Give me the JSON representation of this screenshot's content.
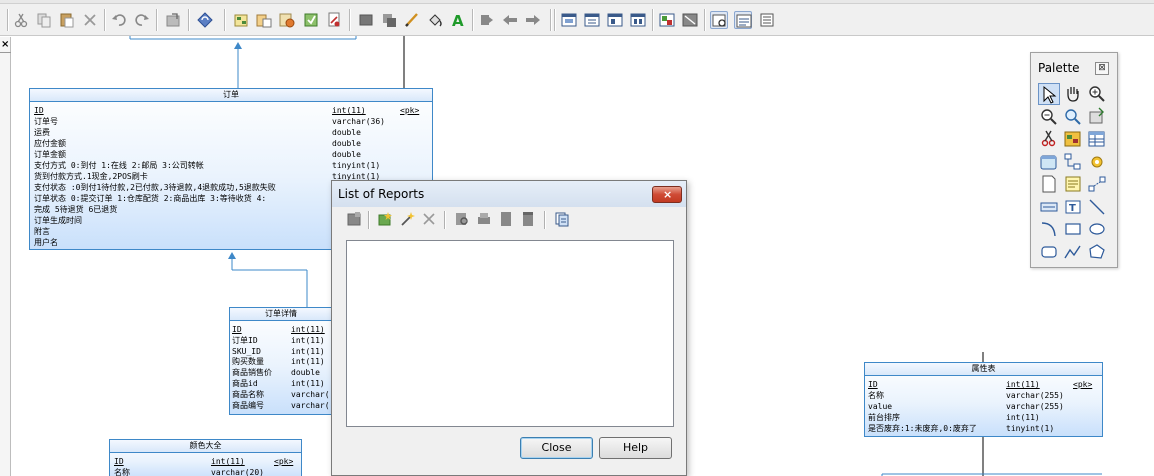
{
  "diagram": {
    "tables": [
      {
        "key": "order",
        "title": "订单",
        "rows": [
          {
            "name": "ID",
            "type": "int(11)",
            "key": "<pk>"
          },
          {
            "name": "订单号",
            "type": "varchar(36)",
            "key": ""
          },
          {
            "name": "运费",
            "type": "double",
            "key": ""
          },
          {
            "name": "应付金额",
            "type": "double",
            "key": ""
          },
          {
            "name": "订单金额",
            "type": "double",
            "key": ""
          },
          {
            "name": "支付方式 0:到付 1:在线 2:邮局 3:公司转帐",
            "type": "tinyint(1)",
            "key": ""
          },
          {
            "name": "货到付款方式.1现金,2POS刷卡",
            "type": "tinyint(1)",
            "key": ""
          },
          {
            "name": "支付状态 :0到付1待付款,2已付款,3待退款,4退款成功,5退款失败",
            "type": "",
            "key": ""
          },
          {
            "name": "订单状态 0:提交订单 1:仓库配货 2:商品出库 3:等待收货 4:",
            "type": "",
            "key": ""
          },
          {
            "name": "完成 5待退货 6已退货",
            "type": "",
            "key": ""
          },
          {
            "name": "订单生成时间",
            "type": "",
            "key": ""
          },
          {
            "name": "附言",
            "type": "",
            "key": ""
          },
          {
            "name": "用户名",
            "type": "",
            "key": ""
          }
        ]
      },
      {
        "key": "order_detail",
        "title": "订单详情",
        "rows": [
          {
            "name": "ID",
            "type": "int(11)",
            "key": ""
          },
          {
            "name": "订单ID",
            "type": "int(11)",
            "key": ""
          },
          {
            "name": "SKU_ID",
            "type": "int(11)",
            "key": ""
          },
          {
            "name": "购买数量",
            "type": "int(11)",
            "key": ""
          },
          {
            "name": "商品销售价",
            "type": "double",
            "key": ""
          },
          {
            "name": "商品id",
            "type": "int(11)",
            "key": ""
          },
          {
            "name": "商品名称",
            "type": "varchar(",
            "key": ""
          },
          {
            "name": "商品编号",
            "type": "varchar(",
            "key": ""
          }
        ]
      },
      {
        "key": "attribute",
        "title": "属性表",
        "rows": [
          {
            "name": "ID",
            "type": "int(11)",
            "key": "<pk>"
          },
          {
            "name": "名称",
            "type": "varchar(255)",
            "key": ""
          },
          {
            "name": "value",
            "type": "varchar(255)",
            "key": ""
          },
          {
            "name": "前台排序",
            "type": "int(11)",
            "key": ""
          },
          {
            "name": "是否废弃:1:未废弃,0:废弃了",
            "type": "tinyint(1)",
            "key": ""
          }
        ]
      },
      {
        "key": "color",
        "title": "颜色大全",
        "rows": [
          {
            "name": "ID",
            "type": "int(11)",
            "key": "<pk>"
          },
          {
            "name": "名称",
            "type": "varchar(20)",
            "key": ""
          }
        ]
      }
    ]
  },
  "dialog": {
    "title": "List of Reports",
    "close_glyph": "×",
    "close_label": "Close",
    "help_label": "Help",
    "tools": [
      "properties-icon",
      "new-report-icon",
      "wizard-icon",
      "delete-icon",
      "preview-icon",
      "print-icon",
      "generate-html-icon",
      "generate-rtf-icon",
      "export-template-icon"
    ]
  },
  "palette": {
    "title": "Palette",
    "close_glyph": "⊠",
    "tools": [
      "pointer-icon",
      "grabber-icon",
      "zoom-in-icon",
      "zoom-out-icon",
      "open-package-icon",
      "properties-icon",
      "delete-icon",
      "package-icon",
      "table-icon",
      "view-icon",
      "reference-icon",
      "procedure-icon",
      "file-icon",
      "note-icon",
      "link-icon",
      "title-icon",
      "text-icon",
      "line-icon",
      "arc-icon",
      "rectangle-icon",
      "ellipse-icon",
      "rounded-rectangle-icon",
      "polyline-icon",
      "polygon-icon"
    ]
  },
  "left_panel": {
    "close_glyph": "×"
  },
  "toolbar": {
    "tools": [
      "cut-icon",
      "copy-icon",
      "paste-icon",
      "delete-icon",
      "undo-icon",
      "redo-icon",
      "open-parent-icon",
      "refresh-icon",
      "new-model-icon",
      "open-icon",
      "save-icon",
      "check-model-icon",
      "generate-icon",
      "reverse-icon",
      "impact-icon",
      "pen-icon",
      "fill-icon",
      "text-color-icon",
      "align-left-icon",
      "back-icon",
      "forward-icon",
      "view-toggle-icon",
      "layout-icon",
      "sheet-icon",
      "report-icon",
      "database-icon",
      "report-list-icon",
      "window-icon",
      "output-icon"
    ]
  }
}
